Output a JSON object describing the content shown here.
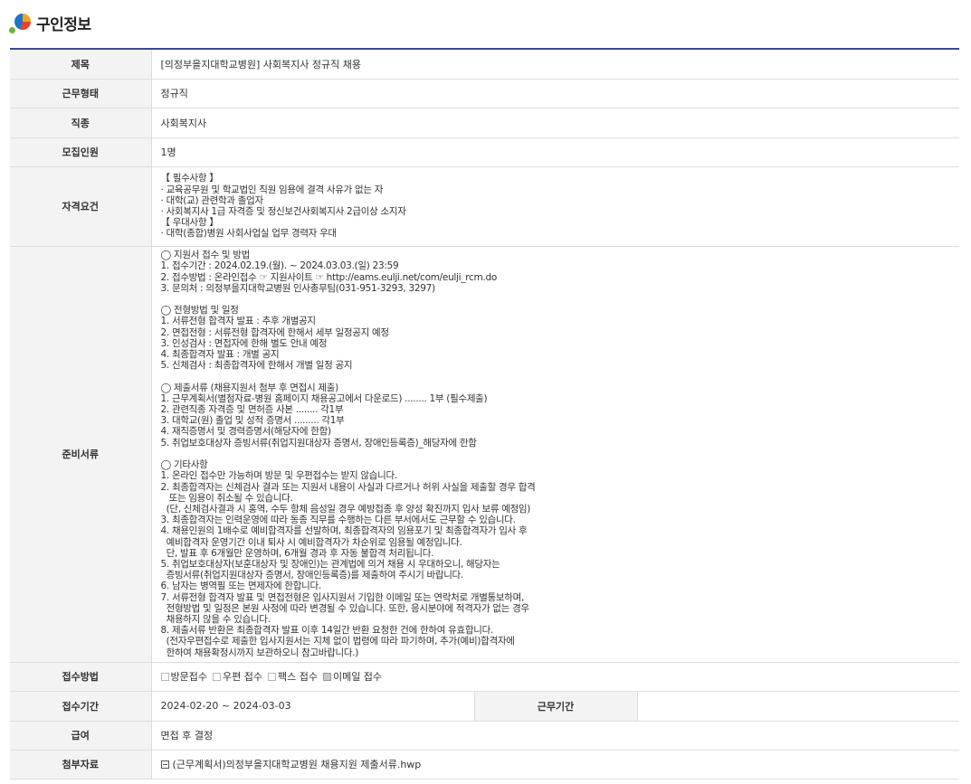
{
  "header": {
    "title": "구인정보"
  },
  "rows": {
    "title": {
      "label": "제목",
      "value": "[의정부을지대학교병원] 사회복지사 정규직 채용"
    },
    "employment_type": {
      "label": "근무형태",
      "value": "정규직"
    },
    "job_category": {
      "label": "직종",
      "value": "사회복지사"
    },
    "headcount": {
      "label": "모집인원",
      "value": "1명"
    },
    "qualifications": {
      "label": "자격요건",
      "lines": [
        "【 필수사항 】",
        "· 교육공무원 및 학교법인 직원 임용에 결격 사유가 없는 자",
        "· 대학(교) 관련학과 졸업자",
        "· 사회복지사 1급 자격증 및 정신보건사회복지사 2급이상 소지자",
        "【 우대사항 】",
        "· 대학(종합)병원 사회사업실 업무 경력자 우대"
      ]
    },
    "documents": {
      "label": "준비서류",
      "lines": [
        "◯ 지원서 접수 및 방법",
        "1. 접수기간 : 2024.02.19.(월). ~ 2024.03.03.(일) 23:59",
        "2. 접수방법 : 온라인접수 ☞ 지원사이트 ☞ http://eams.eulji.net/com/eulji_rcm.do",
        "3. 문의처 : 의정부을지대학교병원 인사총무팀(031-951-3293, 3297)",
        "",
        "◯ 전형방법 및 일정",
        "1. 서류전형 합격자 발표 : 추후 개별공지",
        "2. 면접전형 : 서류전형 합격자에 한해서 세부 일정공지 예정",
        "3. 인성검사 : 면접자에 한해 별도 안내 예정",
        "4. 최종합격자 발표 : 개별 공지",
        "5. 신체검사 : 최종합격자에 한해서 개별 일정 공지",
        "",
        "◯ 제출서류 (채용지원서 첨부 후 면접시 제출)",
        "1. 근무계획서(별첨자료-병원 홈페이지 채용공고에서 다운로드) ........ 1부 (필수제출)",
        "2. 관련직종 자격증 및 면허증 사본 ........ 각1부",
        "3. 대학교(원) 졸업 및 성적 증명서 ......... 각1부",
        "4. 재직증명서 및 경력증명서(해당자에 한함)",
        "5. 취업보호대상자 증빙서류(취업지원대상자 증명서, 장애인등록증)_해당자에 한함",
        "",
        "◯ 기타사항",
        "1. 온라인 접수만 가능하며 방문 및 우편접수는 받지 않습니다.",
        "2. 최종합격자는 신체검사 결과 또는 지원서 내용이 사실과 다르거나 허위 사실을 제출할 경우 합격",
        "   또는 임용이 취소될 수 있습니다.",
        "  (단, 신체검사결과 시 홍역, 수두 항체 음성일 경우 예방접종 후 양성 확진까지 입사 보류 예정임)",
        "3. 최종합격자는 인력운영에 따라 동종 직무를 수행하는 다른 부서에서도 근무할 수 있습니다.",
        "4. 채용인원의 1배수로 예비합격자를 선발하며, 최종합격자의 임용포기 및 최종합격자가 입사 후",
        "  예비합격자 운영기간 이내 퇴사 시 예비합격자가 차순위로 임용될 예정입니다.",
        "  단, 발표 후 6개월만 운영하며, 6개월 경과 후 자동 불합격 처리됩니다.",
        "5. 취업보호대상자(보훈대상자 및 장애인)는 관계법에 의거 채용 시 우대하오니, 해당자는",
        "  증빙서류(취업지원대상자 증명서, 장애인등록증)를 제출하여 주시기 바랍니다.",
        "6. 남자는 병역필 또는 면제자에 한합니다.",
        "7. 서류전형 합격자 발표 및 면접전형은 입사지원서 기입한 이메일 또는 연락처로 개별통보하며,",
        "  전형방법 및 일정은 본원 사정에 따라 변경될 수 있습니다. 또한, 응시분야에 적격자가 없는 경우",
        "  채용하지 않을 수 있습니다.",
        "8. 제출서류 반환은 최종합격자 발표 이후 14일간 반환 요청한 건에 한하여 유효합니다.",
        "  (전자우편접수로 제출한 입사지원서는 지체 없이 법령에 따라 파기하며, 추가(예비)합격자에",
        "  한하여 채용확정시까지 보관하오니 참고바랍니다.)"
      ]
    },
    "apply_method": {
      "label": "접수방법",
      "options": [
        {
          "label": "방문접수",
          "checked": false
        },
        {
          "label": "우편 접수",
          "checked": false
        },
        {
          "label": "팩스 접수",
          "checked": false
        },
        {
          "label": "이메일 접수",
          "checked": true
        }
      ]
    },
    "apply_period": {
      "label": "접수기간",
      "value": "2024-02-20 ~ 2024-03-03",
      "sub_label": "근무기간",
      "sub_value": ""
    },
    "salary": {
      "label": "급여",
      "value": "면접 후 결정"
    },
    "attachment": {
      "label": "첨부자료",
      "file": "(근무계획서)의정부을지대학교병원  채용지원  제출서류.hwp"
    }
  }
}
